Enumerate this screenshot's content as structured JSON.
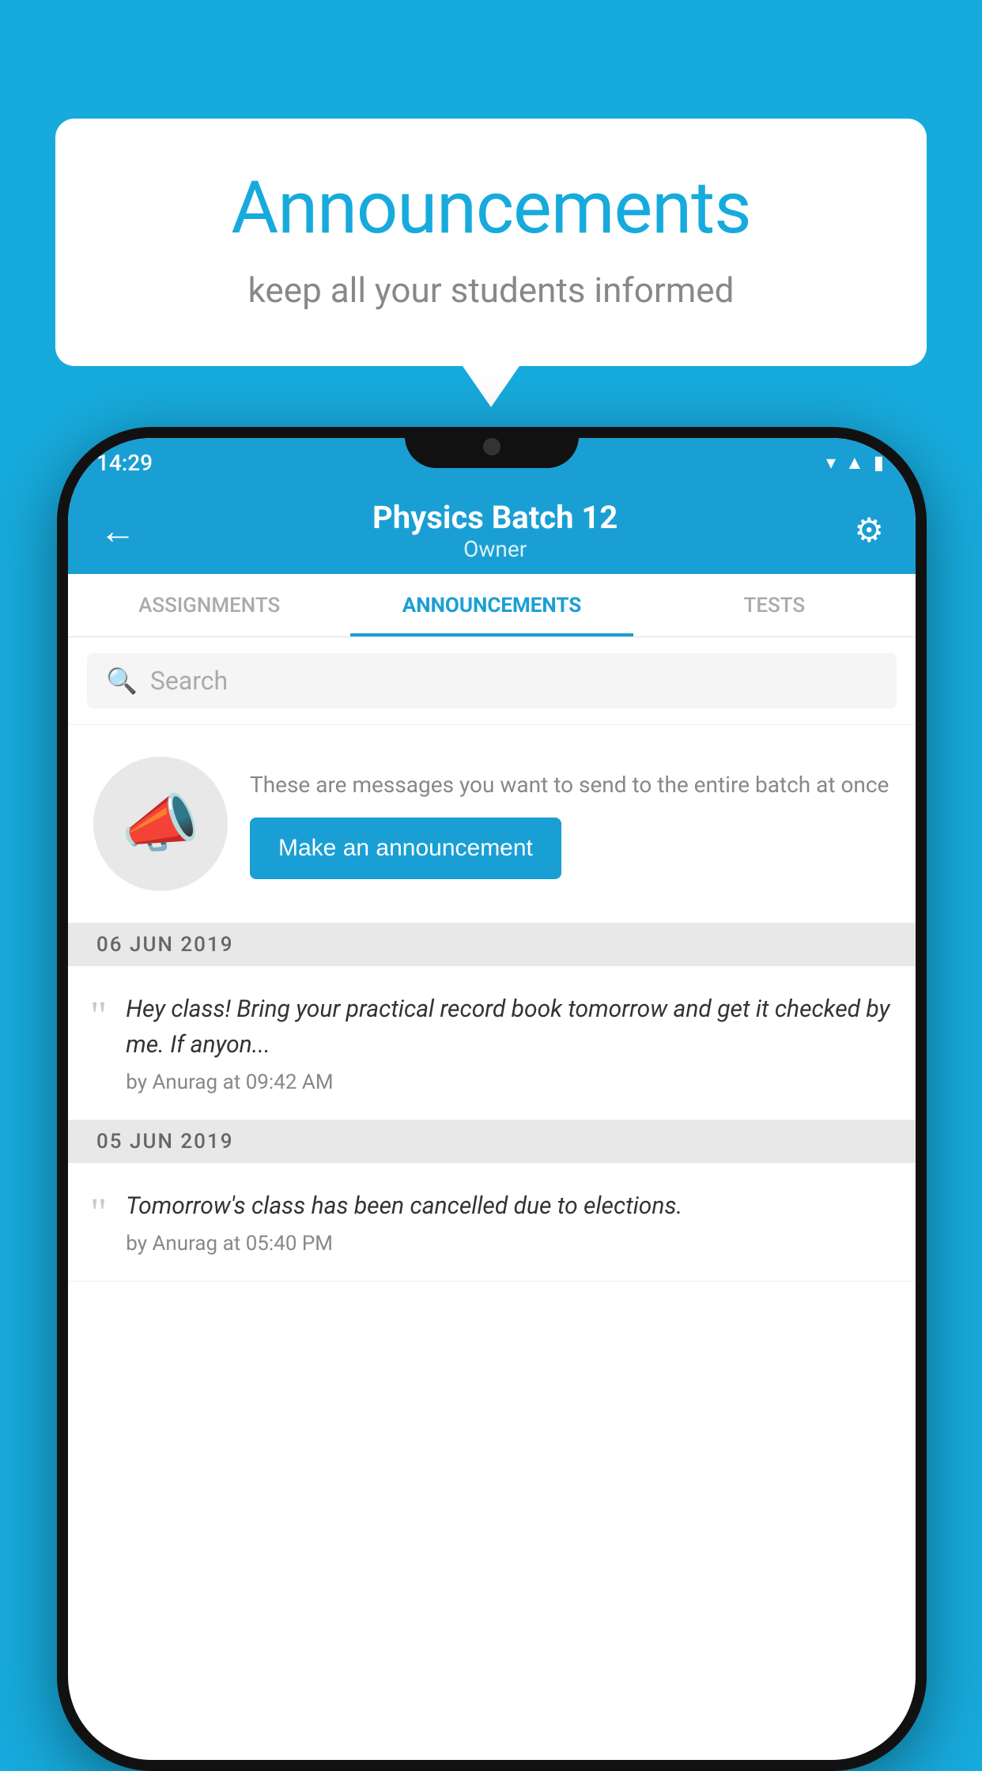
{
  "background": {
    "color": "#17aadc"
  },
  "speech_bubble": {
    "title": "Announcements",
    "subtitle": "keep all your students informed"
  },
  "phone": {
    "status_bar": {
      "time": "14:29",
      "icons": [
        "wifi",
        "signal",
        "battery"
      ]
    },
    "header": {
      "title": "Physics Batch 12",
      "subtitle": "Owner",
      "back_label": "←",
      "settings_label": "⚙"
    },
    "tabs": [
      {
        "label": "ASSIGNMENTS",
        "active": false
      },
      {
        "label": "ANNOUNCEMENTS",
        "active": true
      },
      {
        "label": "TESTS",
        "active": false
      }
    ],
    "search": {
      "placeholder": "Search"
    },
    "promo": {
      "description": "These are messages you want to send to the entire batch at once",
      "button_label": "Make an announcement"
    },
    "announcements": [
      {
        "date": "06  JUN  2019",
        "text": "Hey class! Bring your practical record book tomorrow and get it checked by me. If anyon...",
        "meta": "by Anurag at 09:42 AM"
      },
      {
        "date": "05  JUN  2019",
        "text": "Tomorrow's class has been cancelled due to elections.",
        "meta": "by Anurag at 05:40 PM"
      }
    ]
  }
}
